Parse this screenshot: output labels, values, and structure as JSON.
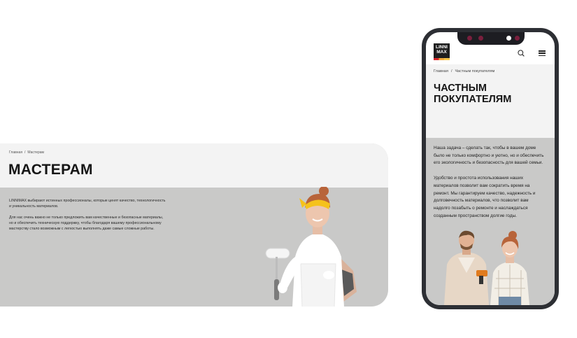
{
  "desktop": {
    "breadcrumb": {
      "home": "Главная",
      "separator": "/",
      "current": "Мастерам"
    },
    "title": "МАСТЕРАМ",
    "paragraphs": [
      "LINNIMAX выбирают истинных профессионалы, которые ценят качество, технологичность и уникальность материалов.",
      "Для нас очень важно не только предложить вам качественные и безопасные материалы, но и обеспечить техническую поддержку, чтобы благодаря вашему профессиональному мастерству стало возможным с легкостью выполнять даже самые сложные работы."
    ]
  },
  "mobile": {
    "logo": {
      "line1": "LINNI",
      "line2": "MAX"
    },
    "icons": {
      "search": "search-icon",
      "menu": "hamburger-menu-icon"
    },
    "breadcrumb": {
      "home": "Главная",
      "separator": "/",
      "current": "Частным покупателям"
    },
    "title": "ЧАСТНЫМ ПОКУПАТЕЛЯМ",
    "paragraphs": [
      "Наша задача – сделать так, чтобы в вашем доме было не только комфортно и уютно, но и обеспечить его экологичность и безопасность для вашей семьи.",
      "Удобство и простота использования наших материалов позволит вам сократить время на ремонт. Мы гарантируем качество, надежность и долговечность материалов, что позволит вам надолго позабыть о ремонте и наслаждаться созданным пространством долгие годы."
    ]
  },
  "colors": {
    "background": "#ffffff",
    "header_gray": "#f3f3f3",
    "content_gray": "#c9c9c8",
    "phone_frame": "#2d2f34",
    "bandana_yellow": "#f5c21b"
  }
}
